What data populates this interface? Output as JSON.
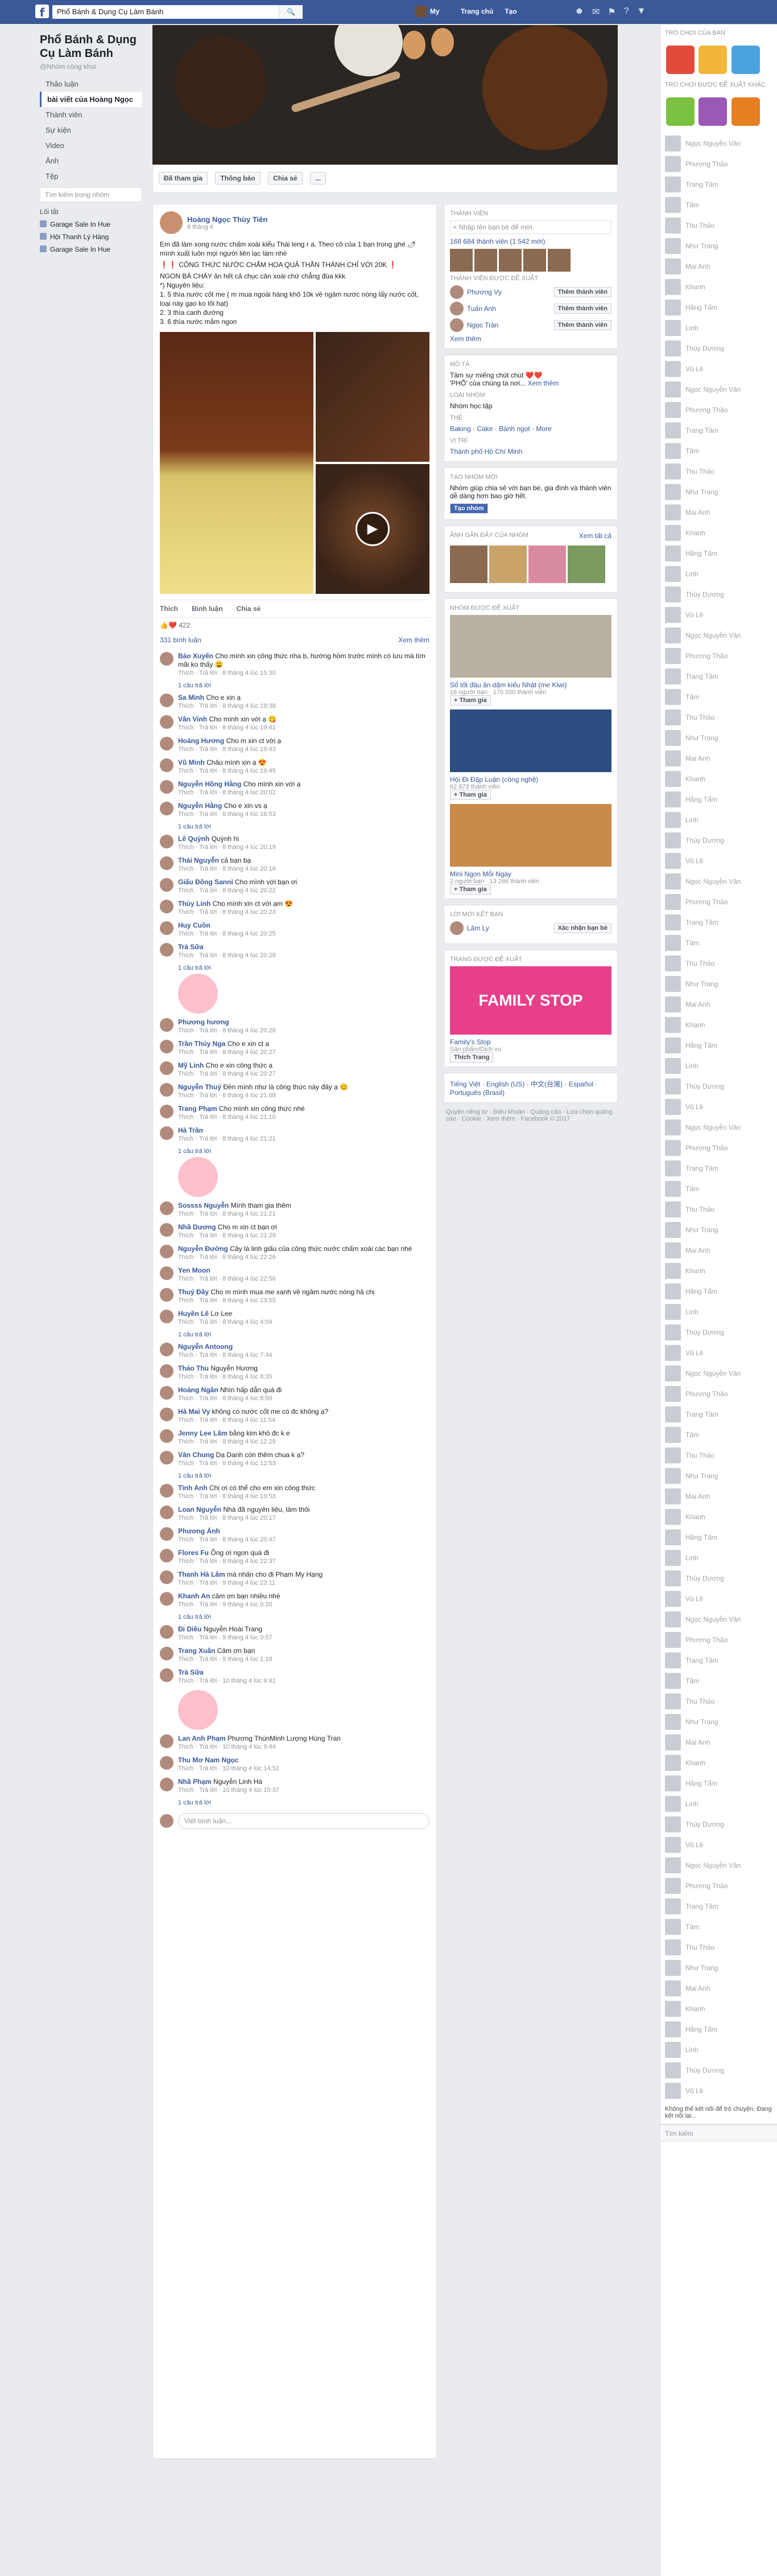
{
  "topbar": {
    "search_text": "Phổ Bánh & Dụng Cụ Làm Bánh",
    "user": "My",
    "home": "Trang chủ",
    "create": "Tạo"
  },
  "page": {
    "name": "Phổ Bánh & Dụng Cụ Làm Bánh",
    "handle": "@Nhóm công khai",
    "nav": [
      "Thảo luận",
      "bài viết của Hoàng Ngọc",
      "Thành viên",
      "Sự kiện",
      "Video",
      "Ảnh",
      "Tệp"
    ],
    "search_placeholder": "Tìm kiếm trong nhóm",
    "shortcuts_label": "Lối tắt",
    "groups": [
      "Garage Sale In Hue",
      "Hội Thanh Lý Hàng",
      "Garage Sale In Hue"
    ],
    "cover_actions": [
      "Đã tham gia",
      "Thông báo",
      "Chia sẻ",
      "..."
    ]
  },
  "post": {
    "author": "Hoàng Ngọc Thùy Tiên",
    "time": "8 tháng 4",
    "text_lines": [
      "Em đã làm xong nước chấm xoài kiểu Thái leng r a. Theo cô của 1 bạn trong ghé 🌶 mình xuất luôn mọi người liên lạc làm nhé",
      "❗❗ CÔNG THỨC NƯỚC CHẤM HOA QUẢ THẦN THÁNH CHỈ VỚI 20K ❗",
      "NGON BÁ CHÁY ăn hết cả chục cân xoài chứ chẳng đùa kkk",
      "*) Nguyên liệu:",
      "1. 5 thìa nước cốt me ( m mua ngoài hàng khô 10k về ngâm nước nóng lấy nước cốt, loại này gạo ko lõi hạt)",
      "2. 3 thìa canh đường",
      "3. 6 thìa nước mắm ngon"
    ],
    "actions": [
      "Thích",
      "Bình luận",
      "Chia sẻ"
    ],
    "reaction_count": "422",
    "comment_count": "331 bình luận",
    "share_label": "Xem thêm",
    "comments": [
      {
        "name": "Bảo Xuyến",
        "text": "Cho mình xin công thức nha b, hướng hồm trước mình có lưu mà tìm mãi ko thấy 😩",
        "meta": "Thích · Trả lời · 8 tháng 4 lúc 15:30"
      },
      {
        "name": "Sa Minh",
        "text": "Cho e xin ạ",
        "meta": "Thích · Trả lời · 8 tháng 4 lúc 19:38"
      },
      {
        "name": "Vân Vinh",
        "text": "Cho mình xin với ạ 😋",
        "meta": "Thích · Trả lời · 8 tháng 4 lúc 19:41"
      },
      {
        "name": "Hoàng Hương",
        "text": "Cho m xin ct với ạ",
        "meta": "Thích · Trả lời · 8 tháng 4 lúc 19:43"
      },
      {
        "name": "Vũ Minh",
        "text": "Châu mình xin ạ 😍",
        "meta": "Thích · Trả lời · 8 tháng 4 lúc 19:45"
      },
      {
        "name": "Nguyễn Hồng Hằng",
        "text": "Cho mình xin với ạ",
        "meta": "Thích · Trả lời · 8 tháng 4 lúc 20:02"
      },
      {
        "name": "Nguyễn Hằng",
        "text": "Cho e xin vs ạ",
        "meta": "Thích · Trả lời · 8 tháng 4 lúc 16:53"
      },
      {
        "name": "Lê Quỳnh",
        "text": "Quỳnh hì",
        "meta": "Thích · Trả lời · 8 tháng 4 lúc 20:19"
      },
      {
        "name": "Thái Nguyễn",
        "text": "cả bạn bạ",
        "meta": "Thích · Trả lời · 8 tháng 4 lúc 20:16"
      },
      {
        "name": "Giấu Đông Sanni",
        "text": "Cho mình với bạn ơi",
        "meta": "Thích · Trả lời · 8 tháng 4 lúc 20:22"
      },
      {
        "name": "Thùy Linh",
        "text": "Cho mình xin ct với ạm 😍",
        "meta": "Thích · Trả lời · 8 tháng 4 lúc 20:23"
      },
      {
        "name": "Huy Cuồn",
        "text": "",
        "meta": "Thích · Trả lời · 8 tháng 4 lúc 20:25"
      },
      {
        "name": "Trà Sữa",
        "text": "",
        "meta": "Thích · Trả lời · 8 tháng 4 lúc 20:26"
      },
      {
        "name": "Phương hương",
        "text": "",
        "meta": "Thích · Trả lời · 8 tháng 4 lúc 20:26"
      },
      {
        "name": "Trần Thúy Nga",
        "text": "Cho e xin ct a",
        "meta": "Thích · Trả lời · 8 tháng 4 lúc 20:27"
      },
      {
        "name": "Mỹ Linh",
        "text": "Cho e xin công thức ạ",
        "meta": "Thích · Trả lời · 8 tháng 4 lúc 20:27"
      },
      {
        "name": "Nguyễn Thuý",
        "text": "Đền mình như là công thức này đây ạ 😊",
        "meta": "Thích · Trả lời · 8 tháng 4 lúc 21:08"
      },
      {
        "name": "Trang Phạm",
        "text": "Cho mình xin công thức nhé",
        "meta": "Thích · Trả lời · 8 tháng 4 lúc 21:10"
      },
      {
        "name": "Hà Trần",
        "text": "",
        "meta": "Thích · Trả lời · 8 tháng 4 lúc 21:21"
      },
      {
        "name": "Sossss Nguyễn",
        "text": "Mình tham gia thêm",
        "meta": "Thích · Trả lời · 8 tháng 4 lúc 21:21"
      },
      {
        "name": "Nhã Dương",
        "text": "Cho m xin ct bạn ơi",
        "meta": "Thích · Trả lời · 8 tháng 4 lúc 21:29"
      },
      {
        "name": "Nguyễn Đường",
        "text": "Cây là linh giấu của công thức nước chấm xoài các bạn nhé",
        "meta": "Thích · Trả lời · 8 tháng 4 lúc 22:26"
      },
      {
        "name": "Yen Moon",
        "text": "",
        "meta": "Thích · Trả lời · 8 tháng 4 lúc 22:56"
      },
      {
        "name": "Thuỷ Đây",
        "text": "Cho m mình mua me xanh về ngâm nước nóng hả chị",
        "meta": "Thích · Trả lời · 8 tháng 4 lúc 23:55"
      },
      {
        "name": "Huyền Lê",
        "text": "Lơ Lee",
        "meta": "Thích · Trả lời · 8 tháng 4 lúc 4:09"
      },
      {
        "name": "Nguyễn Antoong",
        "text": "",
        "meta": "Thích · Trả lời · 8 tháng 4 lúc 7:44"
      },
      {
        "name": "Thảo Thu",
        "text": "Nguyễn Hương",
        "meta": "Thích · Trả lời · 8 tháng 4 lúc 8:35"
      },
      {
        "name": "Hoàng Ngân",
        "text": "Nhìn hấp dẫn quá đi",
        "meta": "Thích · Trả lời · 8 tháng 4 lúc 8:59"
      },
      {
        "name": "Hà Mai Vy",
        "text": "không có nước cốt me có đc không ạ?",
        "meta": "Thích · Trả lời · 8 tháng 4 lúc 11:54"
      },
      {
        "name": "Jenny Lee Lâm",
        "text": "bằng kim khô đc k e",
        "meta": "Thích · Trả lời · 8 tháng 4 lúc 12:29"
      },
      {
        "name": "Văn Chung",
        "text": "Dạ Danh còn thêm chua k ạ?",
        "meta": "Thích · Trả lời · 8 tháng 4 lúc 12:53"
      },
      {
        "name": "Tình Anh",
        "text": "Chị ơi có thể cho em xin công thức",
        "meta": "Thích · Trả lời · 8 tháng 4 lúc 19:53"
      },
      {
        "name": "Loan Nguyễn",
        "text": "Nhà đã nguyên liệu, làm thôi",
        "meta": "Thích · Trả lời · 8 tháng 4 lúc 20:17"
      },
      {
        "name": "Phương Ánh",
        "text": "",
        "meta": "Thích · Trả lời · 8 tháng 4 lúc 20:47"
      },
      {
        "name": "Flores Fu",
        "text": "Ông ơi ngon quá đi",
        "meta": "Thích · Trả lời · 8 tháng 4 lúc 22:37"
      },
      {
        "name": "Thanh Hà Lâm",
        "text": "mà nhấn cho đi Phạm My Hạng",
        "meta": "Thích · Trả lời · 9 tháng 4 lúc 23:11"
      },
      {
        "name": "Khanh An",
        "text": "cảm ơn bạn nhiều nhé",
        "meta": "Thích · Trả lời · 9 tháng 4 lúc 0:20"
      },
      {
        "name": "Đi Diêu",
        "text": "Nguyễn Hoài Trang",
        "meta": "Thích · Trả lời · 9 tháng 4 lúc 0:57"
      },
      {
        "name": "Trang Xuân",
        "text": "Cảm ơn bạn",
        "meta": "Thích · Trả lời · 9 tháng 4 lúc 1:18"
      },
      {
        "name": "Trà Sữa",
        "text": "",
        "meta": "Thích · Trả lời · 10 tháng 4 lúc 9:41"
      },
      {
        "name": "Lan Anh Phạm",
        "text": "Phương ThùnMinh Lượng Hùng Tran",
        "meta": "Thích · Trả lời · 10 tháng 4 lúc 9:44"
      },
      {
        "name": "Thu Mơ Nam Ngọc",
        "text": "",
        "meta": "Thích · Trả lời · 10 tháng 4 lúc 14:52"
      },
      {
        "name": "Nhã Phạm",
        "text": "Nguyễn Linh Hà",
        "meta": "Thích · Trả lời · 10 tháng 4 lúc 15:37"
      }
    ],
    "replies_label": "1 câu trả lời",
    "write_placeholder": "Viết bình luận..."
  },
  "right": {
    "members_title": "THÀNH VIÊN",
    "search_members": "+ Nhập tên bạn bè để mời",
    "members_count": "168 684 thành viên (1 542 mới)",
    "suggested_title": "THÀNH VIÊN ĐƯỢC ĐỀ XUẤT",
    "suggested": [
      "Phương Vy",
      "Tuấn Anh",
      "Ngọc Trần"
    ],
    "add_member": "Thêm thành viên",
    "see_more": "Xem thêm",
    "about_title": "MÔ TẢ",
    "about_text": "Tâm sự miếng chút chút ❤️❤️",
    "about_sub": "'PHỔ' của chúng ta nơi...",
    "about_more": "Xem thêm",
    "type_title": "LOẠI NHÓM",
    "type_value": "Nhóm học tập",
    "tags_title": "THẺ",
    "tags": "Baking · Cake · Bánh ngọt · More",
    "location_title": "VỊ TRÍ",
    "location": "Thành phố Hồ Chí Minh",
    "create_title": "TẠO NHÓM MỚI",
    "create_text": "Nhóm giúp chia sẻ với bạn bè, gia đình và thành viên dễ dàng hơn bao giờ hết.",
    "create_btn": "Tạo nhóm",
    "photos_title": "ẢNH GẦN ĐÂY CỦA NHÓM",
    "photos_more": "Xem tất cả",
    "suggest_groups_title": "NHÓM ĐƯỢC ĐỀ XUẤT",
    "suggest_groups": [
      {
        "name": "Sổ tốt đầu ăn dặm kiểu Nhật (me Kiwi)",
        "meta": "16 người bạn · 170 200 thành viên",
        "btn": "+ Tham gia"
      },
      {
        "name": "Hội Đi Đặp Luận (công nghệ)",
        "meta": "62 873 thành viên",
        "btn": "+ Tham gia"
      },
      {
        "name": "Mini Ngon Mỗi Ngày",
        "meta": "2 người bạn · 13 266 thành viên",
        "btn": "+ Tham gia"
      }
    ],
    "gift_title": "Lời mời kết bạn",
    "gift_name": "Lăm Ly",
    "gift_btn": "Xác nhận bạn bè",
    "ad_title": "Trang được đề xuất",
    "ad_name": "Family's Stop",
    "ad_sub": "Sản phẩm/Dịch vụ",
    "ad_btn": "Thích Trang",
    "languages": "Tiếng Việt · English (US) · 中文(台灣) · Español · Português (Brasil)",
    "footer": "Quyền riêng tư · Điều khoản · Quảng cáo · Lựa chọn quảng cáo · Cookie · Xem thêm · Facebook © 2017"
  },
  "chat": {
    "section": "TRÒ CHƠI CỦA BẠN",
    "section2": "TRÒ CHƠI ĐƯỢC ĐỀ XUẤT KHÁC",
    "search": "Tìm kiếm",
    "notice": "Không thể kết nối để trò chuyện. Đang kết nối lại...",
    "contacts": [
      "Ngọc Nguyễn Văn",
      "Phương Thảo",
      "Trang Tầm",
      "Tâm",
      "Thu Thảo",
      "Như Trang",
      "Mai Anh",
      "Khanh",
      "Hằng Tẩm",
      "Linh",
      "Thùy Dương",
      "Vũ Lê"
    ]
  }
}
